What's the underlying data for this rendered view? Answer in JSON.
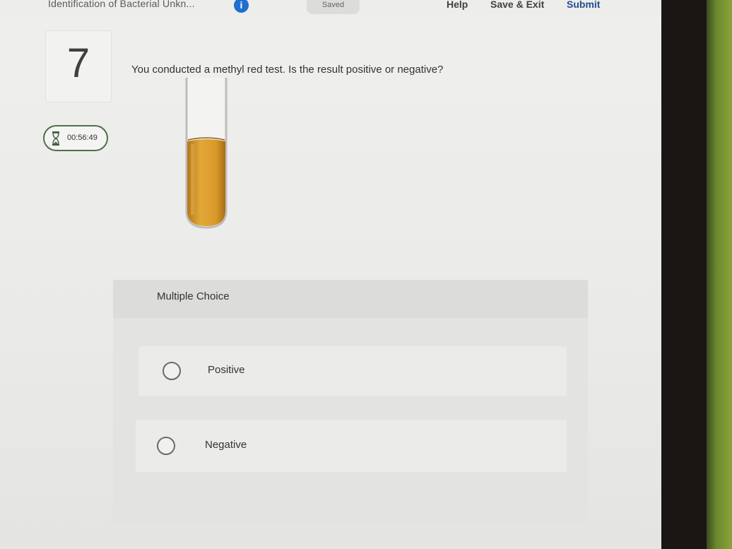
{
  "header": {
    "assignment_title": "Identification of Bacterial Unkn...",
    "info_icon": "info-icon",
    "status": "Saved",
    "links": {
      "help": "Help",
      "save_exit": "Save & Exit",
      "submit": "Submit"
    }
  },
  "question": {
    "number": "7",
    "timer": "00:56:49",
    "text": "You conducted a methyl red test. Is the result positive or negative?"
  },
  "multiple_choice": {
    "label": "Multiple Choice",
    "options": [
      {
        "label": "Positive",
        "selected": false
      },
      {
        "label": "Negative",
        "selected": false
      }
    ]
  },
  "colors": {
    "submit_link": "#234e8c",
    "info_icon": "#1f6fce",
    "timer_border": "#4f6f49",
    "tube_liquid": "#d99a2a"
  }
}
